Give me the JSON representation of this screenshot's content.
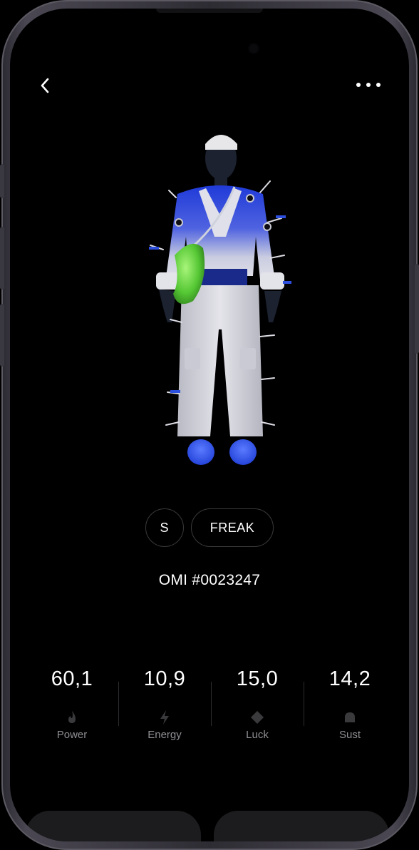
{
  "nav": {
    "back_icon": "chevron-left-icon",
    "more_icon": "ellipsis-icon"
  },
  "avatar": {
    "description_icon": "3d-avatar-figure"
  },
  "chips": {
    "size": "S",
    "tag": "FREAK"
  },
  "token": {
    "id": "OMI #0023247"
  },
  "stats": [
    {
      "value": "60,1",
      "label": "Power",
      "icon": "flame-icon"
    },
    {
      "value": "10,9",
      "label": "Energy",
      "icon": "lightning-icon"
    },
    {
      "value": "15,0",
      "label": "Luck",
      "icon": "diamond-icon"
    },
    {
      "value": "14,2",
      "label": "Sust",
      "icon": "dome-icon"
    }
  ],
  "colors": {
    "background": "#000000",
    "text": "#ffffff",
    "muted": "#8e8e93",
    "accent_blue": "#2d4fe0",
    "accent_green": "#5cdc3a"
  }
}
